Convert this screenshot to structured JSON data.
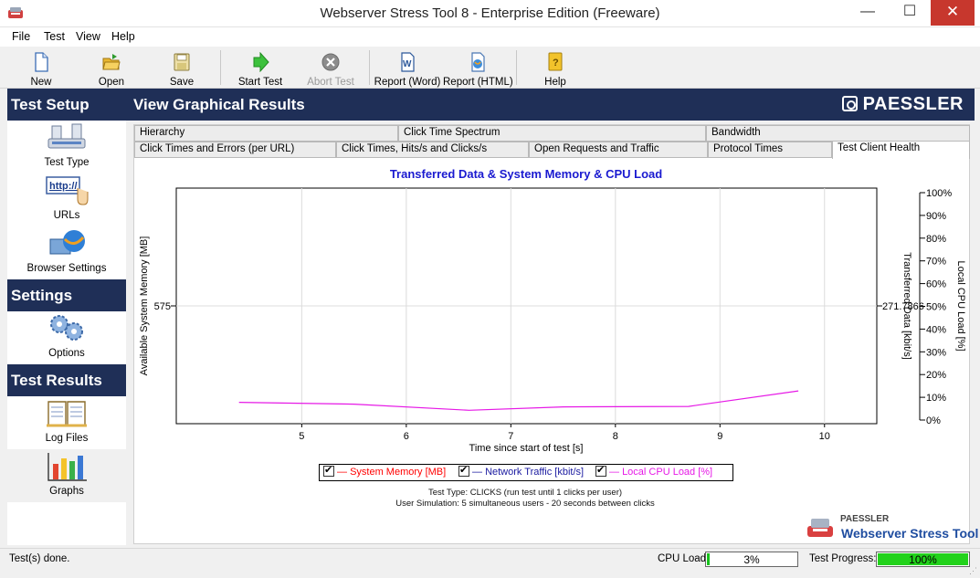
{
  "window": {
    "title": "Webserver Stress Tool 8 - Enterprise Edition (Freeware)",
    "controls": {
      "minimize": "—",
      "maximize": "☐",
      "close": "✕"
    }
  },
  "menu": [
    "File",
    "Test",
    "View",
    "Help"
  ],
  "toolbar": [
    {
      "label": "New",
      "icon": "new-document-icon",
      "enabled": true
    },
    {
      "label": "Open",
      "icon": "open-folder-icon",
      "enabled": true
    },
    {
      "label": "Save",
      "icon": "save-disk-icon",
      "enabled": true
    },
    {
      "label": "Start Test",
      "icon": "start-arrow-icon",
      "enabled": true
    },
    {
      "label": "Abort Test",
      "icon": "abort-icon",
      "enabled": false
    },
    {
      "label": "Report (Word)",
      "icon": "word-report-icon",
      "enabled": true
    },
    {
      "label": "Report (HTML)",
      "icon": "html-report-icon",
      "enabled": true
    },
    {
      "label": "Help",
      "icon": "help-book-icon",
      "enabled": true
    }
  ],
  "sidebar": {
    "sections": [
      {
        "title": "Test Setup",
        "items": [
          {
            "label": "Test Type",
            "icon": "test-type-icon"
          },
          {
            "label": "URLs",
            "icon": "url-icon"
          },
          {
            "label": "Browser Settings",
            "icon": "browser-settings-icon"
          }
        ]
      },
      {
        "title": "Settings",
        "items": [
          {
            "label": "Options",
            "icon": "options-gears-icon"
          }
        ]
      },
      {
        "title": "Test Results",
        "items": [
          {
            "label": "Log Files",
            "icon": "log-files-icon"
          },
          {
            "label": "Graphs",
            "icon": "graphs-icon",
            "active": true
          }
        ]
      }
    ]
  },
  "header": {
    "title": "View Graphical Results",
    "brand": "PAESSLER"
  },
  "tabs": {
    "row1": [
      "Hierarchy",
      "Click Time Spectrum",
      "Bandwidth"
    ],
    "row2": [
      "Click Times and Errors (per URL)",
      "Click Times, Hits/s and Clicks/s",
      "Open Requests and Traffic",
      "Protocol Times",
      "Test Client Health"
    ],
    "active": "Test Client Health"
  },
  "chart_data": {
    "type": "line",
    "title": "Transferred Data & System Memory & CPU Load",
    "xlabel": "Time since start of test [s]",
    "ylabel_left": "Available System Memory [MB]",
    "ylabel_right1": "Transferred Data [kbit/s]",
    "ylabel_right2": "Local CPU Load [%]",
    "xlim": [
      3.8,
      10.5
    ],
    "x_ticks": [
      5,
      6,
      7,
      8,
      9,
      10
    ],
    "left_tick": "575",
    "right1_tick": "271.7866",
    "right2_ticks": [
      "100%",
      "90%",
      "80%",
      "70%",
      "60%",
      "50%",
      "40%",
      "30%",
      "20%",
      "10%",
      "0%"
    ],
    "grid": true,
    "series": [
      {
        "name": "System Memory [MB]",
        "color": "#ff0000",
        "visible": true,
        "x": [],
        "y": []
      },
      {
        "name": "Network Traffic [kbit/s]",
        "color": "#1a1aa0",
        "visible": true,
        "x": [],
        "y": []
      },
      {
        "name": "Local CPU Load [%]",
        "color": "#e619e6",
        "visible": true,
        "x": [
          4.4,
          5.5,
          6.6,
          7.5,
          8.7,
          9.75
        ],
        "y": [
          7.8,
          7.0,
          4.3,
          5.8,
          6.0,
          12.8
        ]
      }
    ]
  },
  "legend": [
    {
      "label": "System Memory [MB]",
      "color": "#ff0000"
    },
    {
      "label": "Network Traffic [kbit/s]",
      "color": "#1a1aa0"
    },
    {
      "label": "Local CPU Load [%]",
      "color": "#e619e6"
    }
  ],
  "info": {
    "line1": "Test Type: CLICKS (run test until 1 clicks per user)",
    "line2": "User Simulation: 5 simultaneous users - 20 seconds between clicks"
  },
  "branding": {
    "small": "PAESSLER",
    "main": "Webserver Stress Tool"
  },
  "status": {
    "text": "Test(s) done.",
    "cpu_label": "CPU Load:",
    "cpu_value": "3%",
    "cpu_fraction": 0.03,
    "progress_label": "Test Progress:",
    "progress_value": "100%",
    "progress_fraction": 1.0
  }
}
